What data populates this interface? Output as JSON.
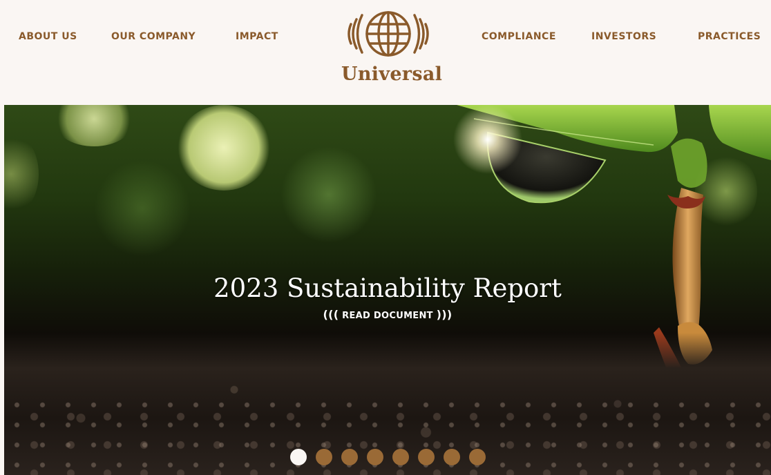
{
  "nav": {
    "left": [
      "ABOUT US",
      "OUR COMPANY",
      "IMPACT"
    ],
    "right": [
      "COMPLIANCE",
      "INVESTORS",
      "PRACTICES"
    ]
  },
  "logo": {
    "text": "Universal",
    "icon": "globe-icon",
    "color": "#8a5a2b"
  },
  "hero": {
    "title": "2023 Sustainability Report",
    "link_open": "(((",
    "link_label": "READ DOCUMENT",
    "link_close": ")))"
  },
  "carousel": {
    "slide_count": 8,
    "active_index": 0,
    "active_color": "#faf6f3",
    "inactive_color": "#9a6a36"
  },
  "colors": {
    "brand": "#8a5a2b",
    "background": "#faf6f3"
  }
}
